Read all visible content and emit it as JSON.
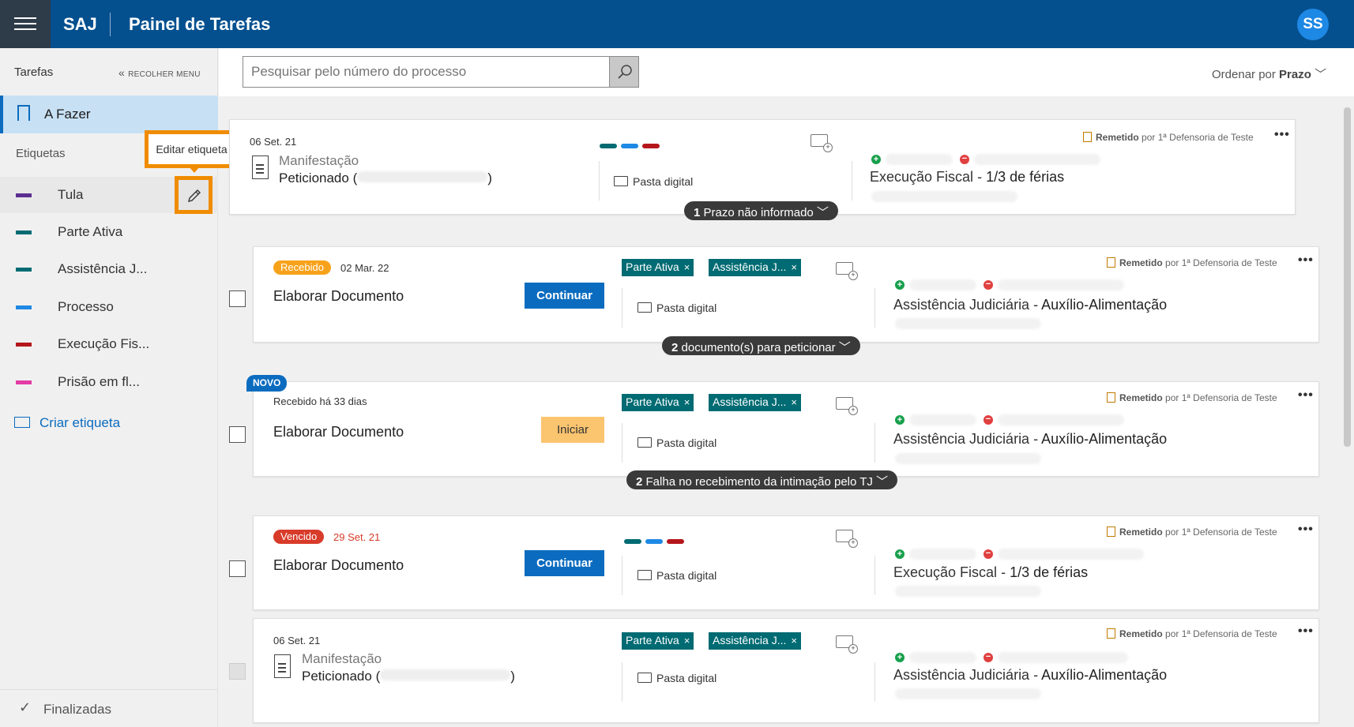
{
  "header": {
    "brand": "SAJ",
    "title": "Painel de Tarefas",
    "avatar": "SS"
  },
  "sidebar": {
    "title": "Tarefas",
    "collapse_label": "RECOLHER MENU",
    "active_item": "A Fazer",
    "tags_label": "Etiquetas",
    "tooltip": "Editar etiqueta",
    "tags": [
      {
        "label": "Tula",
        "color": "#5c2d91"
      },
      {
        "label": "Parte Ativa",
        "color": "#006b73"
      },
      {
        "label": "Assistência J...",
        "color": "#006b73"
      },
      {
        "label": "Processo",
        "color": "#1e88e5"
      },
      {
        "label": "Execução Fis...",
        "color": "#b4161b"
      },
      {
        "label": "Prisão em fl...",
        "color": "#e43ba6"
      }
    ],
    "create_tag": "Criar etiqueta",
    "finished": "Finalizadas"
  },
  "toolbar": {
    "search_placeholder": "Pesquisar pelo número do processo",
    "sort_label": "Ordenar por",
    "sort_value": "Prazo"
  },
  "common": {
    "pasta": "Pasta digital",
    "remetido": "Remetido",
    "por": "por 1ª Defensoria de Teste",
    "continuar": "Continuar",
    "iniciar": "Iniciar",
    "manifestacao": "Manifestação",
    "peticionado": "Peticionado",
    "novo": "NOVO",
    "chip1": "Parte Ativa",
    "chip2": "Assistência J...",
    "chip_x": "×"
  },
  "cards": [
    {
      "date": "06 Set. 21",
      "subject_a": "Execução Fiscal",
      "subject_b": "1/3 de férias",
      "pill_count": "1",
      "pill_text": "Prazo não informado"
    },
    {
      "status": "Recebido",
      "date": "02 Mar. 22",
      "task": "Elaborar Documento",
      "subject_a": "Assistência Judiciária",
      "subject_b": "Auxílio-Alimentação",
      "pill_count": "2",
      "pill_text": "documento(s) para peticionar"
    },
    {
      "date": "Recebido há 33 dias",
      "task": "Elaborar Documento",
      "subject_a": "Assistência Judiciária",
      "subject_b": "Auxílio-Alimentação",
      "pill_count": "2",
      "pill_text": "Falha no recebimento da intimação pelo TJ"
    },
    {
      "status": "Vencido",
      "date": "29 Set. 21",
      "task": "Elaborar Documento",
      "subject_a": "Execução Fiscal",
      "subject_b": "1/3 de férias"
    },
    {
      "date": "06 Set. 21",
      "subject_a": "Assistência Judiciária",
      "subject_b": "Auxílio-Alimentação"
    }
  ],
  "colors": {
    "primary": "#04508f",
    "accent": "#0b6cbf",
    "highlight": "#f08c00",
    "recebido": "#f7a21b",
    "vencido": "#d83b2a"
  }
}
